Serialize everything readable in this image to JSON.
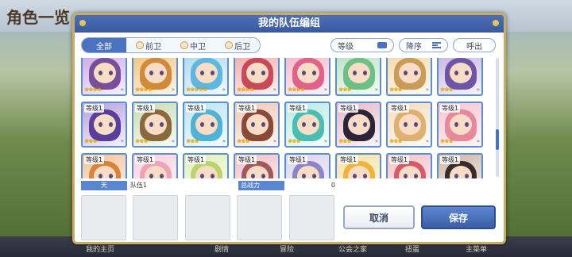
{
  "background": {
    "title": "角色一览",
    "bottom_tabs": [
      "我的主页",
      "剧情",
      "冒险",
      "公会之家",
      "扭蛋",
      "主菜单"
    ]
  },
  "dialog": {
    "title": "我的队伍编组",
    "filters": [
      {
        "label": "全部"
      },
      {
        "label": "前卫"
      },
      {
        "label": "中卫"
      },
      {
        "label": "后卫"
      }
    ],
    "sort_level_label": "等级",
    "order_label": "降序",
    "call_label": "呼出"
  },
  "characters": [
    {
      "level": "",
      "stars": "★★★★",
      "color": "#c9a5e8",
      "hair": "#7a4f9a"
    },
    {
      "level": "",
      "stars": "★★★★",
      "color": "#f2c07a",
      "hair": "#d18a3a"
    },
    {
      "level": "",
      "stars": "★★★★★",
      "color": "#a9d6f2",
      "hair": "#5fb6e0"
    },
    {
      "level": "",
      "stars": "★★★★",
      "color": "#f2a7a7",
      "hair": "#c84a58"
    },
    {
      "level": "",
      "stars": "★★★★",
      "color": "#f5b4c8",
      "hair": "#e0628a"
    },
    {
      "level": "",
      "stars": "★★★",
      "color": "#b8e0c0",
      "hair": "#6cbf85"
    },
    {
      "level": "",
      "stars": "★★★",
      "color": "#f3d7a8",
      "hair": "#c99a58"
    },
    {
      "level": "",
      "stars": "★★★",
      "color": "#c5b1e0",
      "hair": "#6e56a6"
    },
    {
      "level": "等级1",
      "stars": "★★★",
      "color": "#b7a2dd",
      "hair": "#5a3f9a"
    },
    {
      "level": "等级1",
      "stars": "★★★",
      "color": "#c9dcb2",
      "hair": "#8a6a3d"
    },
    {
      "level": "等级1",
      "stars": "★★★",
      "color": "#b9e4f0",
      "hair": "#4fb3d6"
    },
    {
      "level": "等级1",
      "stars": "★★★",
      "color": "#f0c6b6",
      "hair": "#8a4a38"
    },
    {
      "level": "等级1",
      "stars": "★★★",
      "color": "#b9eae4",
      "hair": "#48bfb2"
    },
    {
      "level": "等级1",
      "stars": "★★★",
      "color": "#e6b9c8",
      "hair": "#2c2438"
    },
    {
      "level": "等级1",
      "stars": "★★★",
      "color": "#f4dcc0",
      "hair": "#e0b070"
    },
    {
      "level": "等级1",
      "stars": "★★★",
      "color": "#f6c4d0",
      "hair": "#e8889c"
    },
    {
      "level": "等级1",
      "stars": "",
      "color": "#f3c19a",
      "hair": "#d9823a"
    },
    {
      "level": "等级1",
      "stars": "",
      "color": "#f8d0dc",
      "hair": "#f0a2b8"
    },
    {
      "level": "等级1",
      "stars": "",
      "color": "#e2efb9",
      "hair": "#b8d46a"
    },
    {
      "level": "等级1",
      "stars": "",
      "color": "#f0c0c8",
      "hair": "#a15a5a"
    },
    {
      "level": "等级1",
      "stars": "",
      "color": "#d9d2f0",
      "hair": "#8e84c9"
    },
    {
      "level": "等级1",
      "stars": "",
      "color": "#f6e0a6",
      "hair": "#f0b43a"
    },
    {
      "level": "等级1",
      "stars": "",
      "color": "#f5c0c8",
      "hair": "#d85a6a"
    },
    {
      "level": "等级1",
      "stars": "",
      "color": "#cbb6a4",
      "hair": "#3a2a2a"
    }
  ],
  "team": {
    "tag": "天",
    "name": "队伍1",
    "power_label": "总战力",
    "power_value": "0"
  },
  "buttons": {
    "cancel": "取消",
    "save": "保存"
  }
}
